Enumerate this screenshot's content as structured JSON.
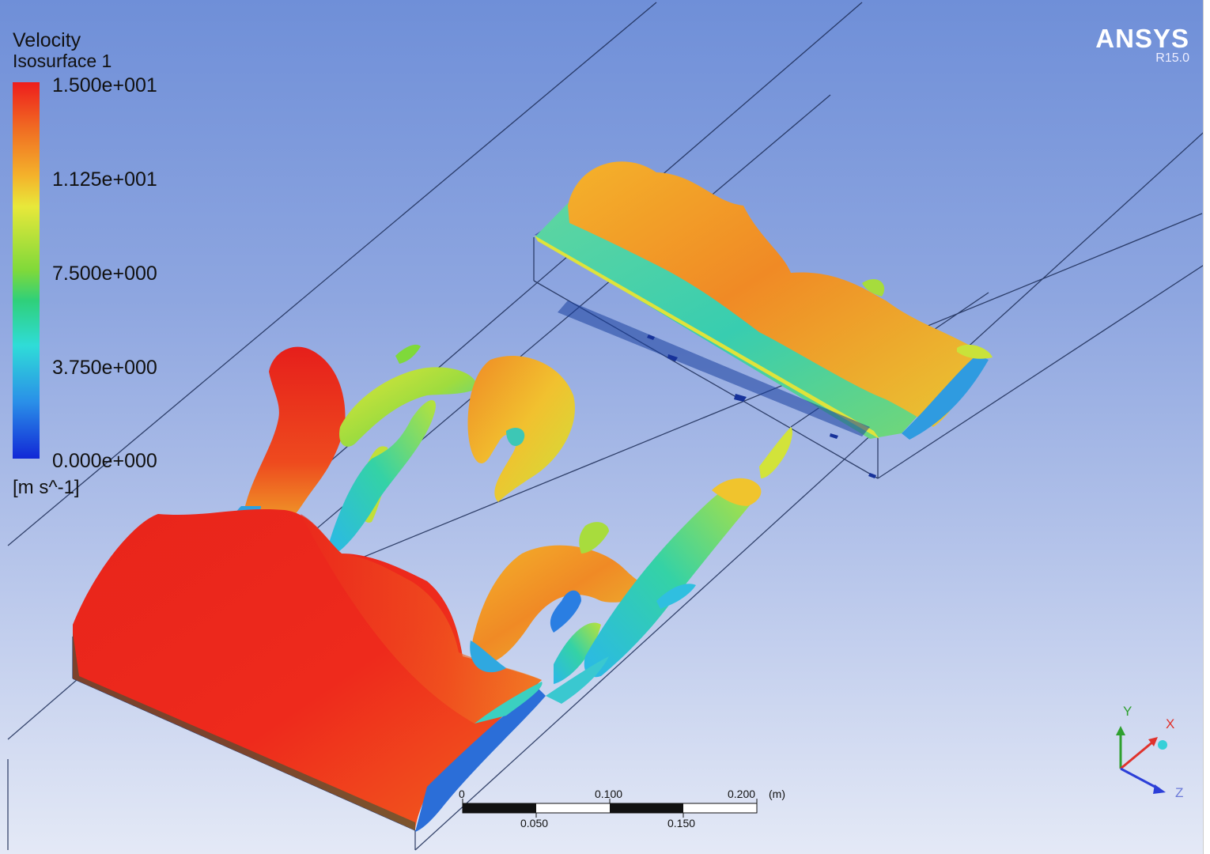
{
  "legend": {
    "variable": "Velocity",
    "location": "Isosurface 1",
    "ticks": [
      "1.500e+001",
      "1.125e+001",
      "7.500e+000",
      "3.750e+000",
      "0.000e+000"
    ],
    "unit": "[m s^-1]",
    "colormap": [
      "#ee1d1d",
      "#f4b32b",
      "#e8e83a",
      "#2fd07a",
      "#2fdcd8",
      "#1228d6"
    ]
  },
  "brand": {
    "name": "ANSYS",
    "version": "R15.0"
  },
  "scale_bar": {
    "top_labels": [
      "0",
      "0.100",
      "0.200"
    ],
    "bottom_labels": [
      "0.050",
      "0.150"
    ],
    "unit": "(m)"
  },
  "axes": {
    "y": "Y",
    "x": "X",
    "z": "Z",
    "colors": {
      "y": "#2fa02f",
      "x": "#e0322c",
      "z": "#2c3fd8"
    }
  }
}
